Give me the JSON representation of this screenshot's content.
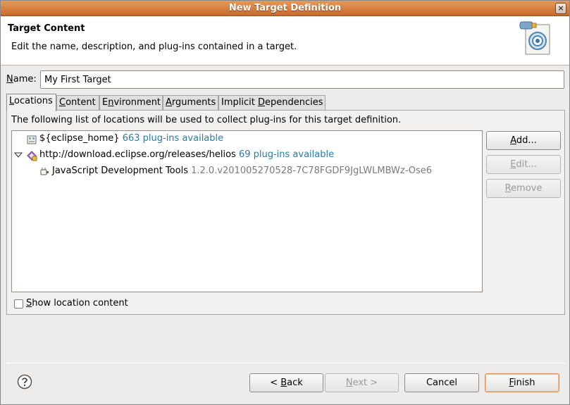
{
  "window": {
    "title": "New Target Definition",
    "close_glyph": "×"
  },
  "header": {
    "title": "Target Content",
    "description": "Edit the name, description, and plug-ins contained in a target."
  },
  "name_field": {
    "label_mnemonic": "N",
    "label_rest": "ame:",
    "value": "My First Target"
  },
  "tabs": [
    {
      "mn": "L",
      "rest": "ocations",
      "pre": "",
      "active": true
    },
    {
      "pre": "",
      "mn": "C",
      "rest": "ontent"
    },
    {
      "pre": "E",
      "mn": "n",
      "rest": "vironment"
    },
    {
      "pre": "",
      "mn": "A",
      "rest": "rguments"
    },
    {
      "pre": "Implicit ",
      "mn": "D",
      "rest": "ependencies"
    }
  ],
  "locations": {
    "description": "The following list of locations will be used to collect plug-ins for this target definition.",
    "rows": [
      {
        "label": "${eclipse_home}",
        "count": "663 plug-ins available"
      },
      {
        "label": "http://download.eclipse.org/releases/helios",
        "count": "69 plug-ins available"
      },
      {
        "label": "JavaScript Development Tools",
        "version": "1.2.0.v201005270528-7C78FGDF9JgLWLMBWz-Ose6"
      }
    ],
    "buttons": {
      "add": {
        "mn": "A",
        "rest": "dd..."
      },
      "edit": {
        "mn": "E",
        "rest": "dit..."
      },
      "remove": {
        "mn": "R",
        "rest": "emove"
      }
    },
    "show_location": {
      "mn": "S",
      "rest": "how location content",
      "checked": false
    }
  },
  "footer": {
    "back": {
      "pre": "< ",
      "mn": "B",
      "rest": "ack"
    },
    "next": {
      "pre": "",
      "mn": "N",
      "rest": "ext >"
    },
    "cancel": "Cancel",
    "finish": {
      "mn": "F",
      "rest": "inish"
    }
  },
  "colors": {
    "titlebar": "#d07a3a",
    "count": "#2a7ba8",
    "version": "#7a7a7a"
  }
}
